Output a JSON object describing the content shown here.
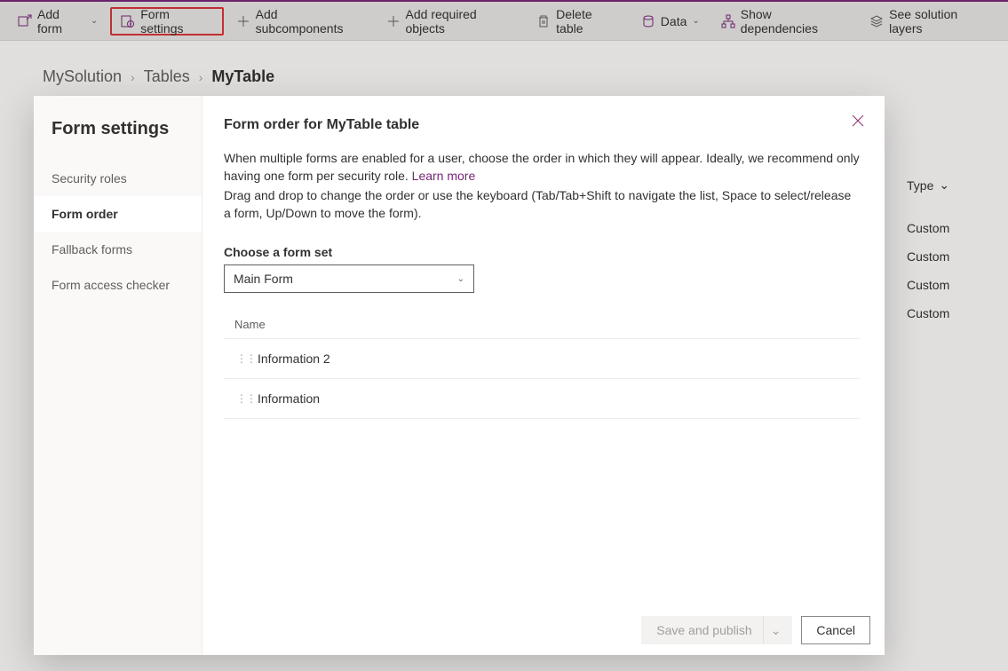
{
  "toolbar": {
    "add_form": "Add form",
    "form_settings": "Form settings",
    "add_subcomponents": "Add subcomponents",
    "add_required": "Add required objects",
    "delete_table": "Delete table",
    "data": "Data",
    "show_dependencies": "Show dependencies",
    "see_solution_layers": "See solution layers"
  },
  "breadcrumb": {
    "solution": "MySolution",
    "tables": "Tables",
    "current": "MyTable"
  },
  "bg_table": {
    "type_header": "Type",
    "rows": [
      "Custom",
      "Custom",
      "Custom",
      "Custom"
    ]
  },
  "dialog": {
    "nav_title": "Form settings",
    "nav_items": [
      "Security roles",
      "Form order",
      "Fallback forms",
      "Form access checker"
    ],
    "active_nav_index": 1,
    "heading": "Form order for MyTable table",
    "desc1": "When multiple forms are enabled for a user, choose the order in which they will appear. Ideally, we recommend only having one form per security role. ",
    "learn_more": "Learn more",
    "desc2": "Drag and drop to change the order or use the keyboard (Tab/Tab+Shift to navigate the list, Space to select/release a form, Up/Down to move the form).",
    "formset_label": "Choose a form set",
    "formset_value": "Main Form",
    "list_header": "Name",
    "list_items": [
      "Information 2",
      "Information"
    ],
    "save_label": "Save and publish",
    "cancel_label": "Cancel"
  }
}
